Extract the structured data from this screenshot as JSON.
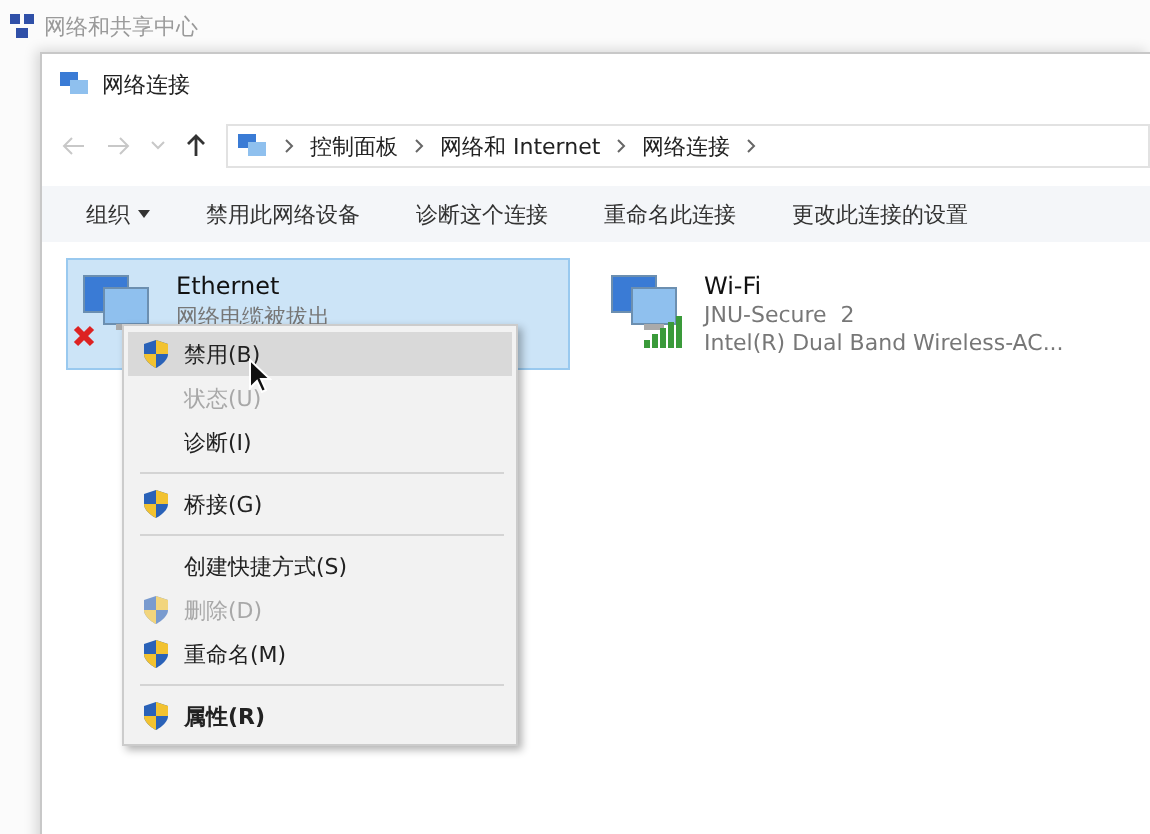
{
  "background_window": {
    "title": "网络和共享中心"
  },
  "window": {
    "title": "网络连接"
  },
  "address_bar": {
    "crumbs": [
      "控制面板",
      "网络和 Internet",
      "网络连接"
    ]
  },
  "command_bar": [
    {
      "label": "组织",
      "dropdown": true
    },
    {
      "label": "禁用此网络设备",
      "dropdown": false
    },
    {
      "label": "诊断这个连接",
      "dropdown": false
    },
    {
      "label": "重命名此连接",
      "dropdown": false
    },
    {
      "label": "更改此连接的设置",
      "dropdown": false
    }
  ],
  "connections": [
    {
      "name": "Ethernet",
      "status": "网络电缆被拔出",
      "kind": "wired",
      "disconnected": true,
      "selected": true
    },
    {
      "name": "Wi-Fi",
      "status": "JNU-Secure  2",
      "device": "Intel(R) Dual Band Wireless-AC...",
      "kind": "wireless",
      "disconnected": false,
      "selected": false
    }
  ],
  "context_menu": [
    {
      "kind": "item",
      "label": "禁用(B)",
      "shield": true,
      "disabled": false,
      "selected": true,
      "bold": false
    },
    {
      "kind": "item",
      "label": "状态(U)",
      "shield": false,
      "disabled": true,
      "selected": false,
      "bold": false
    },
    {
      "kind": "item",
      "label": "诊断(I)",
      "shield": false,
      "disabled": false,
      "selected": false,
      "bold": false
    },
    {
      "kind": "separator"
    },
    {
      "kind": "item",
      "label": "桥接(G)",
      "shield": true,
      "disabled": false,
      "selected": false,
      "bold": false
    },
    {
      "kind": "separator"
    },
    {
      "kind": "item",
      "label": "创建快捷方式(S)",
      "shield": false,
      "disabled": false,
      "selected": false,
      "bold": false
    },
    {
      "kind": "item",
      "label": "删除(D)",
      "shield": true,
      "disabled": true,
      "selected": false,
      "bold": false
    },
    {
      "kind": "item",
      "label": "重命名(M)",
      "shield": true,
      "disabled": false,
      "selected": false,
      "bold": false
    },
    {
      "kind": "separator"
    },
    {
      "kind": "item",
      "label": "属性(R)",
      "shield": true,
      "disabled": false,
      "selected": false,
      "bold": true
    }
  ]
}
